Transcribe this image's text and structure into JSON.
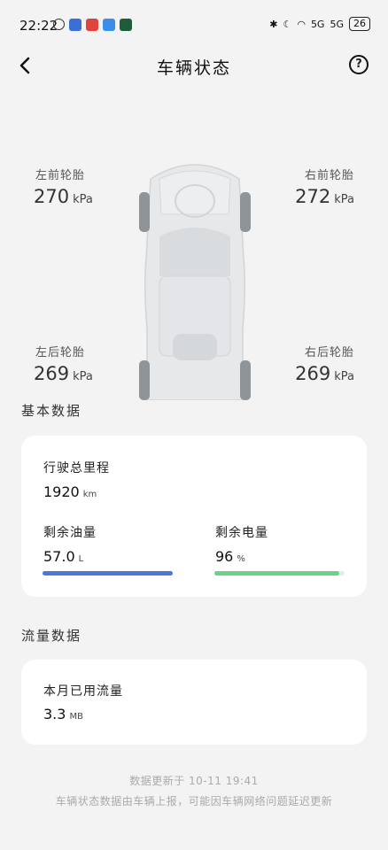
{
  "status_bar": {
    "time": "22:22",
    "signal_label_1": "5G",
    "signal_label_2": "5G",
    "battery": "26"
  },
  "header": {
    "title": "车辆状态",
    "help_icon": "question-circle-icon",
    "back_icon": "chevron-left-icon"
  },
  "tires": {
    "front_left": {
      "label": "左前轮胎",
      "value": "270",
      "unit": "kPa"
    },
    "front_right": {
      "label": "右前轮胎",
      "value": "272",
      "unit": "kPa"
    },
    "rear_left": {
      "label": "左后轮胎",
      "value": "269",
      "unit": "kPa"
    },
    "rear_right": {
      "label": "右后轮胎",
      "value": "269",
      "unit": "kPa"
    }
  },
  "basic": {
    "section_title": "基本数据",
    "mileage": {
      "label": "行驶总里程",
      "value": "1920",
      "unit": "km"
    },
    "fuel": {
      "label": "剩余油量",
      "value": "57.0",
      "unit": "L",
      "level": 1.0,
      "color": "#4a79d8"
    },
    "battery": {
      "label": "剩余电量",
      "value": "96",
      "unit": "%",
      "level": 0.96,
      "color": "#6ad38a"
    }
  },
  "traffic": {
    "section_title": "流量数据",
    "used": {
      "label": "本月已用流量",
      "value": "3.3",
      "unit": "MB"
    }
  },
  "footer": {
    "updated": "数据更新于 10-11 19:41",
    "note": "车辆状态数据由车辆上报，可能因车辆网络问题延迟更新"
  }
}
